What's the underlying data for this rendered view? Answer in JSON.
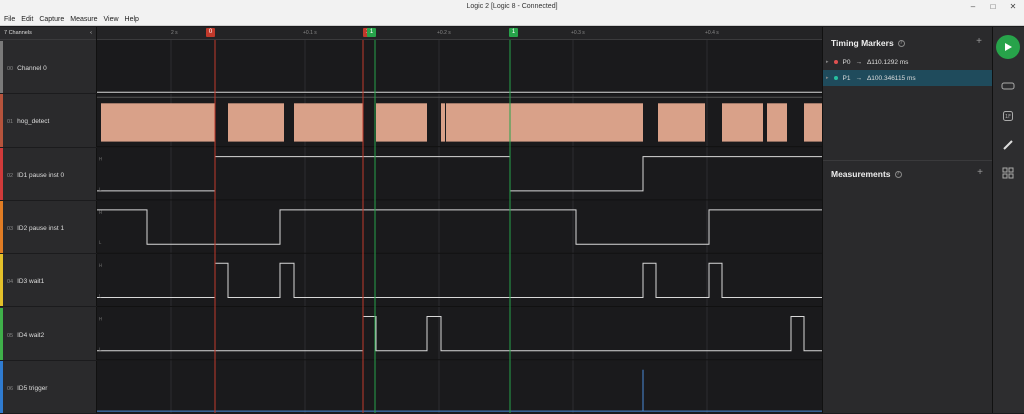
{
  "window": {
    "title": "Logic 2 [Logic 8 - Connected]"
  },
  "menu": [
    "File",
    "Edit",
    "Capture",
    "Measure",
    "View",
    "Help"
  ],
  "channels_header": {
    "label": "7 Channels",
    "collapse_icon": "chevron-left-icon"
  },
  "channels": [
    {
      "num": "00",
      "name": "Channel 0",
      "color": "#7a7a7a"
    },
    {
      "num": "01",
      "name": "hog_detect",
      "color": "#b5533c"
    },
    {
      "num": "02",
      "name": "ID1 pause inst 0",
      "color": "#d03a3a"
    },
    {
      "num": "03",
      "name": "ID2 pause inst 1",
      "color": "#e07c24"
    },
    {
      "num": "04",
      "name": "ID3 wait1",
      "color": "#e3c02a"
    },
    {
      "num": "05",
      "name": "ID4 wait2",
      "color": "#3fb04a"
    },
    {
      "num": "06",
      "name": "ID5 trigger",
      "color": "#2f7bd0"
    }
  ],
  "ruler": {
    "ticks": [
      "2 s",
      "+0.1 s",
      "+0.2 s",
      "+0.3 s",
      "+0.4 s"
    ],
    "markers": [
      {
        "label": "0",
        "color": "#c0392b"
      },
      {
        "label": "1",
        "color": "#c0392b"
      },
      {
        "label": "1",
        "color": "#27a34a"
      },
      {
        "label": "1",
        "color": "#27a34a"
      }
    ]
  },
  "timing_markers": {
    "title": "Timing Markers",
    "items": [
      {
        "name": "P0",
        "arrow": "→",
        "value": "Δ110.1292 ms",
        "color": "#e05050"
      },
      {
        "name": "P1",
        "arrow": "→",
        "value": "Δ100.346115 ms",
        "color": "#27c0a0"
      }
    ]
  },
  "measurements": {
    "title": "Measurements"
  },
  "colors": {
    "accent": "#27a34a",
    "selected_row": "#1f4b5c",
    "wave": "#d8d8d8",
    "hog_fill": "#d9a189"
  }
}
